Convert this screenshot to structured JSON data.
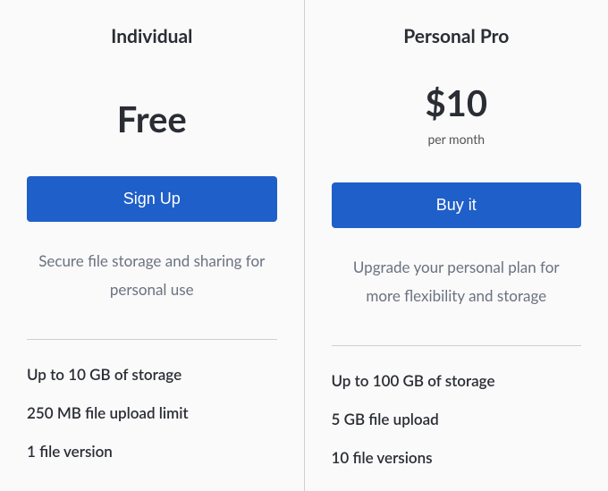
{
  "plans": [
    {
      "name": "Individual",
      "price": "Free",
      "period": "",
      "cta": "Sign Up",
      "description": "Secure file storage and sharing for personal use",
      "features": [
        "Up to 10 GB of storage",
        "250 MB file upload limit",
        "1 file version"
      ]
    },
    {
      "name": "Personal Pro",
      "price": "$10",
      "period": "per month",
      "cta": "Buy it",
      "description": "Upgrade your personal plan for more flexibility and storage",
      "features": [
        "Up to 100 GB of storage",
        "5 GB file upload",
        "10 file versions"
      ]
    }
  ]
}
